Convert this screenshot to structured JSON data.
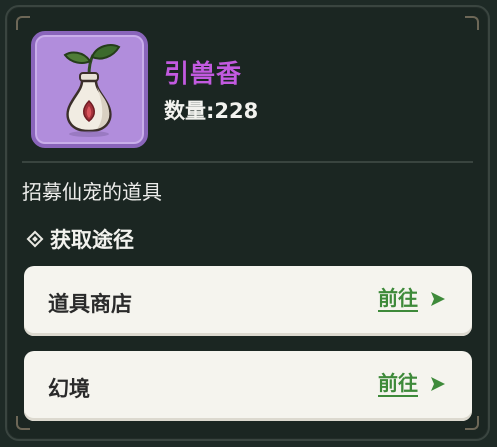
{
  "item": {
    "name": "引兽香",
    "count_text": "数量:228",
    "description": "招募仙宠的道具",
    "icon": "flower-vase-icon",
    "rarity_color": "#b18ddc"
  },
  "sources": {
    "heading": "获取途径",
    "items": [
      {
        "name": "道具商店",
        "action": "前往"
      },
      {
        "name": "幻境",
        "action": "前往"
      }
    ]
  },
  "colors": {
    "name": "#c25ae0",
    "action": "#3e8a3a",
    "panel": "#1b2622"
  }
}
